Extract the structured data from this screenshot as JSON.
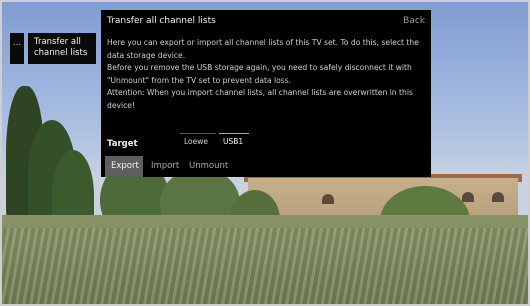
{
  "menu": {
    "stub_label": "...",
    "item_label_line1": "Transfer all",
    "item_label_line2": "channel lists"
  },
  "dialog": {
    "title": "Transfer all channel lists",
    "back_label": "Back",
    "description": [
      "Here you can export or import all channel lists of this TV set. To do this, select the data storage device.",
      "Before you remove the USB storage again, you need to safely disconnect it with \"Unmount\" from the TV set to prevent data loss.",
      "Attention: When you import channel lists, all channel lists are overwritten in this device!"
    ],
    "target_label": "Target",
    "targets": [
      {
        "label": "Loewe",
        "selected": false
      },
      {
        "label": "USB1",
        "selected": true
      }
    ],
    "actions": [
      {
        "label": "Export",
        "active": true
      },
      {
        "label": "Import",
        "active": false
      },
      {
        "label": "Unmount",
        "active": false
      }
    ]
  },
  "colors": {
    "panel_bg": "#000000",
    "active_action_bg": "#5e5e5e",
    "text_primary": "#f0f0f0",
    "text_secondary": "#cfcfcf"
  }
}
